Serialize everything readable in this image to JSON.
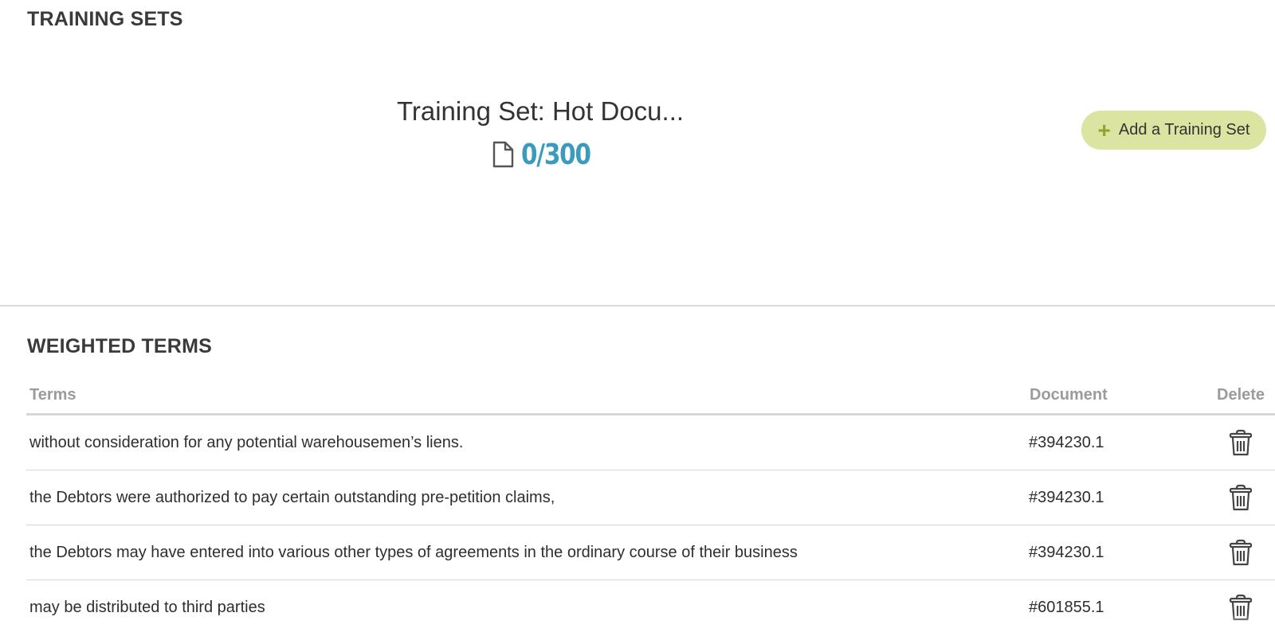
{
  "training_sets": {
    "section_title": "TRAINING SETS",
    "set": {
      "name": "Training Set: Hot Docu...",
      "progress_label": "0/300",
      "progress": {
        "reviewed": 0,
        "total": 300
      },
      "icon": "document-icon"
    },
    "add_button": {
      "label": "Add a Training Set",
      "icon": "plus-icon"
    }
  },
  "weighted_terms": {
    "section_title": "WEIGHTED TERMS",
    "columns": {
      "terms": "Terms",
      "document": "Document",
      "delete": "Delete"
    },
    "rows": [
      {
        "term": "without consideration for any potential warehousemen’s liens.",
        "document": "#394230.1"
      },
      {
        "term": "the Debtors were authorized to pay certain outstanding pre-petition claims,",
        "document": "#394230.1"
      },
      {
        "term": "the Debtors may have entered into various other types of agreements in the ordinary course of their business",
        "document": "#394230.1"
      },
      {
        "term": "may be distributed to third parties",
        "document": "#601855.1"
      }
    ],
    "delete_icon": "trash-icon"
  },
  "colors": {
    "accent": "#3a9bbd",
    "button_bg": "#dce4a2",
    "plus": "#8ea42e",
    "header_text": "#9b9b9b",
    "divider": "#d6d6d6"
  }
}
